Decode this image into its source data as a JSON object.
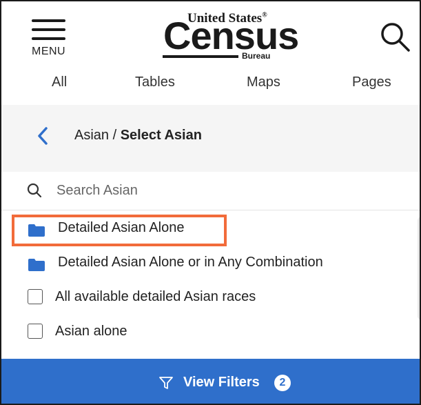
{
  "header": {
    "menu_label": "MENU",
    "logo": {
      "top": "United States",
      "registered": "®",
      "main": "Census",
      "bureau": "Bureau"
    }
  },
  "tabs": [
    {
      "label": "All"
    },
    {
      "label": "Tables"
    },
    {
      "label": "Maps"
    },
    {
      "label": "Pages"
    }
  ],
  "breadcrumb": {
    "parent": "Asian",
    "separator": " / ",
    "current": "Select Asian"
  },
  "search": {
    "placeholder": "Search Asian",
    "value": ""
  },
  "items": [
    {
      "type": "folder",
      "label": "Detailed Asian Alone",
      "highlighted": true
    },
    {
      "type": "folder",
      "label": "Detailed Asian Alone or in Any Combination"
    },
    {
      "type": "checkbox",
      "label": "All available detailed Asian races",
      "checked": false
    },
    {
      "type": "checkbox",
      "label": "Asian alone",
      "checked": false
    }
  ],
  "footer": {
    "label": "View Filters",
    "count": "2"
  },
  "colors": {
    "accent": "#2f6fcb",
    "highlight": "#f26b3a",
    "folder": "#2f6fcb"
  },
  "icons": [
    "menu-icon",
    "search-icon",
    "chevron-left-icon",
    "folder-icon",
    "filter-icon"
  ]
}
